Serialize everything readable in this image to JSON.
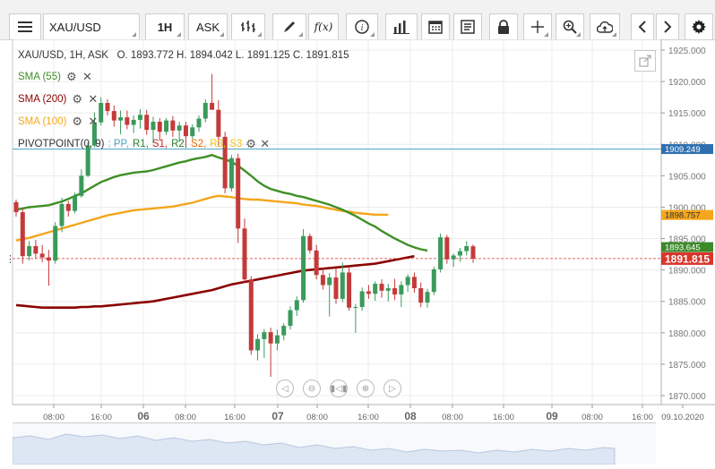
{
  "toolbar": {
    "symbol": "XAU/USD",
    "timeframe": "1H",
    "price_side": "ASK",
    "buttons": [
      {
        "name": "menu-icon"
      },
      {
        "name": "symbol-select"
      },
      {
        "name": "timeframe-select"
      },
      {
        "name": "price-side-select"
      },
      {
        "name": "chart-type-icon"
      },
      {
        "name": "draw-pencil-icon"
      },
      {
        "name": "function-icon"
      },
      {
        "name": "info-icon"
      },
      {
        "name": "bar-stats-icon"
      },
      {
        "name": "calendar-icon"
      },
      {
        "name": "news-icon"
      },
      {
        "name": "lock-icon"
      },
      {
        "name": "crosshair-icon"
      },
      {
        "name": "zoom-icon"
      },
      {
        "name": "cloud-upload-icon"
      },
      {
        "name": "back-arrow-icon"
      },
      {
        "name": "forward-arrow-icon"
      },
      {
        "name": "gear-icon"
      }
    ],
    "function_label": "f(x)"
  },
  "legend": {
    "ohlc_title": "XAU/USD, 1H, ASK   O. 1893.772 H. 1894.042 L. 1891.125 C. 1891.815",
    "sma55": "SMA (55)",
    "sma200": "SMA (200)",
    "sma100": "SMA (100)",
    "pivot_prefix": "PIVOTPOINT(0, 9)",
    "pivot_pp": ": PP,",
    "pivot_r1": "R1,",
    "pivot_s1": "S1,",
    "pivot_r2": "R2,",
    "pivot_s2": "S2,",
    "pivot_r3": "R3,",
    "pivot_s3": "S3"
  },
  "colors": {
    "up": "#3a9a5b",
    "down": "#c43a3a",
    "sma55": "#3f8f26",
    "sma100": "#f4a61c",
    "sma200": "#8b0000",
    "pivot": "#4da6c8",
    "price_badge": "#d9352b",
    "sma100_badge": "#f4a61c",
    "sma55_badge": "#3b8a2a",
    "pivot_badge": "#2f6fb1"
  },
  "chart_data": {
    "type": "candlestick",
    "title": "XAU/USD, 1H, ASK",
    "ohlc_last": {
      "open": 1893.772,
      "high": 1894.042,
      "low": 1891.125,
      "close": 1891.815
    },
    "y_ticks": [
      "1925.000",
      "1920.000",
      "1915.000",
      "1910.000",
      "1905.000",
      "1900.000",
      "1895.000",
      "1890.000",
      "1885.000",
      "1880.000",
      "1875.000",
      "1870.000"
    ],
    "y_values": [
      1925,
      1920,
      1915,
      1910,
      1905,
      1900,
      1895,
      1890,
      1885,
      1880,
      1875,
      1870
    ],
    "ylim": [
      1867.5,
      1926.5
    ],
    "x_labels": [
      "08:00",
      "16:00",
      "06",
      "08:00",
      "16:00",
      "07",
      "08:00",
      "16:00",
      "08",
      "08:00",
      "16:00",
      "09",
      "08:00",
      "16:00",
      "09.10.2020"
    ],
    "x_bold": [
      false,
      false,
      true,
      false,
      false,
      true,
      false,
      false,
      true,
      false,
      false,
      true,
      false,
      false,
      false
    ],
    "price_labels": {
      "pivot": "1909.249",
      "sma100": "1898.757",
      "sma55": "1893.645",
      "last": "1891.815"
    },
    "price_values": {
      "pivot": 1909.249,
      "sma100": 1898.757,
      "sma55": 1893.645,
      "last": 1891.815
    },
    "candles": [
      [
        1900.8,
        1901.2,
        1898.5,
        1899.2
      ],
      [
        1899.2,
        1899.8,
        1891,
        1892.2
      ],
      [
        1892.2,
        1894.6,
        1891.5,
        1893.8
      ],
      [
        1893.8,
        1894.8,
        1891.8,
        1892.6
      ],
      [
        1892.6,
        1894,
        1891.2,
        1892
      ],
      [
        1892,
        1893.2,
        1887.5,
        1891.5
      ],
      [
        1891.5,
        1897.6,
        1891,
        1897
      ],
      [
        1897,
        1901.5,
        1896,
        1900.5
      ],
      [
        1900.5,
        1901,
        1898.5,
        1899.4
      ],
      [
        1899.4,
        1902.3,
        1899,
        1901.8
      ],
      [
        1901.8,
        1906,
        1901.5,
        1905
      ],
      [
        1905,
        1910.3,
        1904.8,
        1909.8
      ],
      [
        1909.8,
        1915.1,
        1909.5,
        1913.5
      ],
      [
        1913.5,
        1917.5,
        1913,
        1916.6
      ],
      [
        1916.6,
        1917.2,
        1914.6,
        1915.3
      ],
      [
        1915.3,
        1916.2,
        1912.8,
        1913.8
      ],
      [
        1913.8,
        1915.4,
        1911.6,
        1914.3
      ],
      [
        1914.3,
        1915.4,
        1912.4,
        1913.1
      ],
      [
        1913.1,
        1914.6,
        1911.8,
        1913.9
      ],
      [
        1913.9,
        1915.6,
        1912.5,
        1914.7
      ],
      [
        1914.7,
        1915.5,
        1911.5,
        1912.3
      ],
      [
        1912.3,
        1914.4,
        1910.2,
        1913.6
      ],
      [
        1913.6,
        1914.2,
        1910.6,
        1912
      ],
      [
        1912,
        1914.2,
        1911.5,
        1913.8
      ],
      [
        1913.8,
        1914.5,
        1911.2,
        1912.2
      ],
      [
        1912.2,
        1913.6,
        1910.4,
        1913
      ],
      [
        1913,
        1913.6,
        1909.5,
        1911.3
      ],
      [
        1911.3,
        1913.2,
        1910.8,
        1912.7
      ],
      [
        1912.7,
        1914.6,
        1912,
        1914.1
      ],
      [
        1914.1,
        1917.2,
        1913.5,
        1916.6
      ],
      [
        1916.6,
        1921.2,
        1916,
        1915.5
      ],
      [
        1915.5,
        1917,
        1909.6,
        1911.2
      ],
      [
        1911.2,
        1912,
        1902.2,
        1903
      ],
      [
        1903,
        1908.3,
        1902.5,
        1907.8
      ],
      [
        1907.8,
        1908.5,
        1894.3,
        1896.6
      ],
      [
        1896.6,
        1898.2,
        1888,
        1888.5
      ],
      [
        1888.5,
        1889,
        1876.5,
        1877.2
      ],
      [
        1877.2,
        1879.8,
        1875.6,
        1879
      ],
      [
        1879,
        1880.6,
        1876,
        1880.1
      ],
      [
        1880.1,
        1880.8,
        1873,
        1878.3
      ],
      [
        1878.3,
        1880.5,
        1877.2,
        1879.6
      ],
      [
        1879.6,
        1881.5,
        1878.8,
        1881.1
      ],
      [
        1881.1,
        1884.2,
        1880.5,
        1883.6
      ],
      [
        1883.6,
        1885.8,
        1882.7,
        1885.2
      ],
      [
        1885.2,
        1896.5,
        1884.8,
        1895.4
      ],
      [
        1895.4,
        1895.8,
        1892.6,
        1893.1
      ],
      [
        1893.1,
        1894,
        1888.5,
        1889.2
      ],
      [
        1889.2,
        1890.3,
        1886.9,
        1887.6
      ],
      [
        1887.6,
        1889.5,
        1882.6,
        1888.8
      ],
      [
        1888.8,
        1890.2,
        1884.6,
        1885.4
      ],
      [
        1885.4,
        1891.2,
        1884.9,
        1889.6
      ],
      [
        1889.6,
        1890.6,
        1883.5,
        1884
      ],
      [
        1884,
        1884.6,
        1880,
        1884.1
      ],
      [
        1884.1,
        1887.2,
        1883.5,
        1886.6
      ],
      [
        1886.6,
        1887.6,
        1885.4,
        1886.2
      ],
      [
        1886.2,
        1888.2,
        1885.1,
        1887.8
      ],
      [
        1887.8,
        1888.5,
        1885.6,
        1886.7
      ],
      [
        1886.7,
        1887.8,
        1885,
        1887.1
      ],
      [
        1887.1,
        1888.6,
        1885.2,
        1886.1
      ],
      [
        1886.1,
        1888.2,
        1884.1,
        1887.6
      ],
      [
        1887.6,
        1889.3,
        1886.5,
        1888.9
      ],
      [
        1888.9,
        1889.6,
        1886.4,
        1887.1
      ],
      [
        1887.1,
        1888,
        1884.1,
        1884.8
      ],
      [
        1884.8,
        1887,
        1884,
        1886.5
      ],
      [
        1886.5,
        1890.5,
        1886,
        1890.1
      ],
      [
        1890.1,
        1895.8,
        1889.6,
        1895.2
      ],
      [
        1895.2,
        1895.6,
        1891,
        1891.7
      ],
      [
        1891.7,
        1892.6,
        1890.5,
        1892.3
      ],
      [
        1892.3,
        1893.5,
        1891.3,
        1893
      ],
      [
        1893,
        1894.6,
        1892.3,
        1893.8
      ],
      [
        1893.772,
        1894.042,
        1891.125,
        1891.815
      ]
    ],
    "sma55": [
      1899.6,
      1899.8,
      1900,
      1900.1,
      1900.2,
      1900.3,
      1900.6,
      1900.9,
      1901.3,
      1901.8,
      1902.2,
      1902.8,
      1903.4,
      1904,
      1904.4,
      1904.8,
      1905.1,
      1905.3,
      1905.5,
      1905.6,
      1905.7,
      1905.9,
      1906.2,
      1906.5,
      1906.8,
      1907.1,
      1907.3,
      1907.6,
      1907.8,
      1908,
      1908.3,
      1907.9,
      1907.6,
      1907.2,
      1906.6,
      1905.8,
      1905,
      1904.1,
      1903.4,
      1902.9,
      1902.6,
      1902.3,
      1902.1,
      1901.8,
      1901.6,
      1901.3,
      1901,
      1900.7,
      1900.4,
      1900,
      1899.6,
      1899.1,
      1898.6,
      1898,
      1897.4,
      1896.9,
      1896.2,
      1895.6,
      1895,
      1894.5,
      1894,
      1893.6,
      1893.3,
      1893.1
    ],
    "sma100": [
      1894.7,
      1894.9,
      1895.1,
      1895.4,
      1895.7,
      1896,
      1896.3,
      1896.6,
      1896.9,
      1897.2,
      1897.5,
      1897.8,
      1898.1,
      1898.4,
      1898.7,
      1898.9,
      1899.1,
      1899.3,
      1899.5,
      1899.6,
      1899.7,
      1899.8,
      1899.9,
      1900,
      1900.1,
      1900.3,
      1900.5,
      1900.7,
      1901,
      1901.3,
      1901.6,
      1901.8,
      1901.7,
      1901.6,
      1901.4,
      1901.3,
      1901.2,
      1901.2,
      1901.1,
      1901,
      1900.9,
      1900.8,
      1900.7,
      1900.6,
      1900.4,
      1900.3,
      1900.2,
      1900,
      1899.8,
      1899.6,
      1899.4,
      1899.3,
      1899.1,
      1899,
      1898.9,
      1898.8,
      1898.8,
      1898.8
    ],
    "sma200": [
      1884.4,
      1884.3,
      1884.2,
      1884.1,
      1884,
      1884,
      1884,
      1884,
      1884,
      1884,
      1884.1,
      1884.1,
      1884.2,
      1884.2,
      1884.3,
      1884.4,
      1884.5,
      1884.6,
      1884.7,
      1884.8,
      1884.9,
      1885,
      1885.2,
      1885.4,
      1885.6,
      1885.8,
      1886,
      1886.2,
      1886.4,
      1886.6,
      1886.8,
      1887.1,
      1887.4,
      1887.7,
      1887.9,
      1888.1,
      1888.3,
      1888.5,
      1888.7,
      1888.9,
      1889.1,
      1889.3,
      1889.5,
      1889.7,
      1889.9,
      1890,
      1890.1,
      1890.2,
      1890.3,
      1890.4,
      1890.5,
      1890.6,
      1890.7,
      1890.8,
      1890.9,
      1891,
      1891.2,
      1891.4,
      1891.6,
      1891.8,
      1892,
      1892.2
    ]
  }
}
